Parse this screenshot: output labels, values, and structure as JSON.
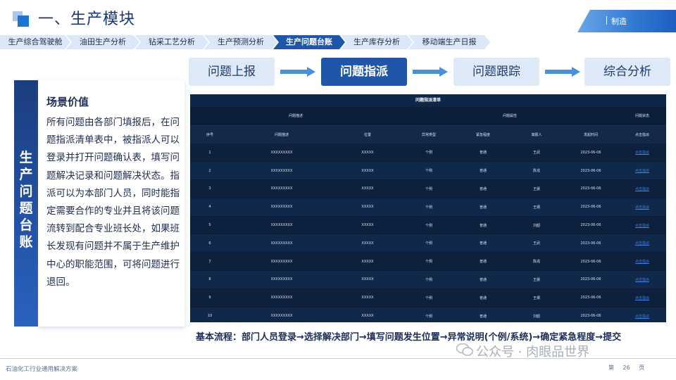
{
  "header": {
    "title": "一、生产模块",
    "tag": "制造"
  },
  "tabs": [
    {
      "label": "生产综合驾驶舱",
      "active": false
    },
    {
      "label": "油田生产分析",
      "active": false
    },
    {
      "label": "钻采工艺分析",
      "active": false
    },
    {
      "label": "生产预测分析",
      "active": false
    },
    {
      "label": "生产问题台账",
      "active": true
    },
    {
      "label": "生产库存分析",
      "active": false
    },
    {
      "label": "移动端生产日报",
      "active": false
    }
  ],
  "steps": [
    {
      "label": "问题上报",
      "active": false
    },
    {
      "label": "问题指派",
      "active": true
    },
    {
      "label": "问题跟踪",
      "active": false
    },
    {
      "label": "综合分析",
      "active": false
    }
  ],
  "side": {
    "vertical_title": [
      "生",
      "产",
      "问",
      "题",
      "台",
      "账"
    ],
    "heading": "场景价值",
    "body": "所有问题由各部门填报后，在问题指派清单表中，被指派人可以登录并打开问题确认表，填写问题解决记录和问题解决状态。指派可以为本部门人员，同时能指定需要合作的专业并且将该问题流转到配合专业班长处，如果班长发现有问题并不属于生产维护中心的职能范围，可将问题进行退回。"
  },
  "table": {
    "title": "问题指派清单",
    "groups": [
      "问题描述",
      "问题属性",
      "问题状态"
    ],
    "columns": [
      "序号",
      "问题描述",
      "位置",
      "异常类型",
      "紧急程度",
      "填报人",
      "发起时间",
      "点击指派"
    ],
    "rows": [
      [
        "1",
        "XXXXXXXXX",
        "XXXXX",
        "个例",
        "普通",
        "王武",
        "2023-06-06",
        "点击指派"
      ],
      [
        "2",
        "XXXXXXXXX",
        "XXXXX",
        "个例",
        "普通",
        "陈戎",
        "2023-06-06",
        "点击指派"
      ],
      [
        "3",
        "XXXXXXXXX",
        "XXXXX",
        "个例",
        "普通",
        "王晨",
        "2023-06-06",
        "点击指派"
      ],
      [
        "4",
        "XXXXXXXXX",
        "XXXXX",
        "个例",
        "普通",
        "王炯",
        "2023-06-06",
        "点击指派"
      ],
      [
        "5",
        "XXXXXXXXX",
        "XXXXX",
        "个例",
        "普通",
        "刘韶",
        "2023-06-06",
        "点击指派"
      ],
      [
        "6",
        "XXXXXXXXX",
        "XXXXX",
        "个例",
        "普通",
        "王武",
        "2023-06-06",
        "点击指派"
      ],
      [
        "7",
        "XXXXXXXXX",
        "XXXXX",
        "个例",
        "普通",
        "陈戎",
        "2023-06-06",
        "点击指派"
      ],
      [
        "8",
        "XXXXXXXXX",
        "XXXXX",
        "个例",
        "普通",
        "王晨",
        "2023-06-06",
        "点击指派"
      ],
      [
        "9",
        "XXXXXXXXX",
        "XXXXX",
        "个例",
        "普通",
        "王炯",
        "2023-06-06",
        "点击指派"
      ],
      [
        "10",
        "XXXXXXXXX",
        "XXXXX",
        "个例",
        "普通",
        "刘韶",
        "2023-06-06",
        "点击指派"
      ]
    ]
  },
  "flow_text": "基本流程：部门人员登录→选择解决部门→填写问题发生位置→异常说明(个例/系统)→确定紧急程度→提交",
  "watermark": "公众号 · 肉眼品世界",
  "footer": {
    "text": "石油化工行业通用解决方案",
    "page_prefix": "第",
    "page_number": "26",
    "page_suffix": "页"
  },
  "colors": {
    "primary": "#1f56a8",
    "step_inactive": "#dde9f6",
    "arrow": "#4a8fd8",
    "table_bg": "#0b1e3a"
  },
  "icons": {
    "watermark": "wechat-icon",
    "arrow": "right-arrow-icon"
  }
}
